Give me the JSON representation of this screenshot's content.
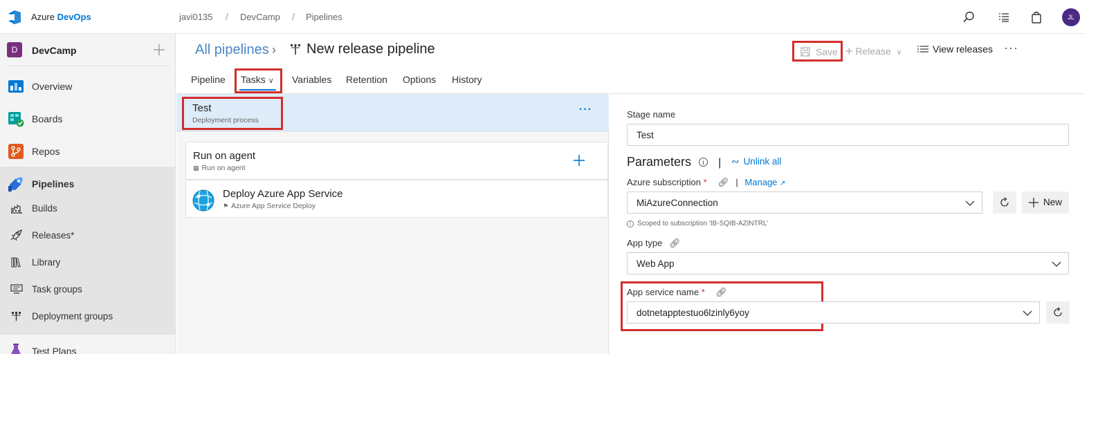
{
  "app": {
    "brand_prefix": "Azure ",
    "brand_suffix": "DevOps",
    "breadcrumb": [
      "javi0135",
      "DevCamp",
      "Pipelines"
    ],
    "avatar_initials": "JL"
  },
  "sidebar": {
    "project_initial": "D",
    "project_name": "DevCamp",
    "items": [
      {
        "label": "Overview",
        "icon": "overview-icon"
      },
      {
        "label": "Boards",
        "icon": "boards-icon"
      },
      {
        "label": "Repos",
        "icon": "repos-icon"
      },
      {
        "label": "Pipelines",
        "icon": "pipelines-icon"
      }
    ],
    "sub_items": [
      {
        "label": "Builds",
        "icon": "builds-icon"
      },
      {
        "label": "Releases*",
        "icon": "rocket-icon"
      },
      {
        "label": "Library",
        "icon": "library-icon"
      },
      {
        "label": "Task groups",
        "icon": "task-groups-icon"
      },
      {
        "label": "Deployment groups",
        "icon": "deployment-groups-icon"
      }
    ],
    "next_item": {
      "label": "Test Plans",
      "icon": "test-plans-icon"
    }
  },
  "header": {
    "all_pipelines": "All pipelines",
    "chevron": "›",
    "title": "New release pipeline",
    "save_label": "Save",
    "release_label": "Release",
    "view_releases_label": "View releases",
    "more": "···"
  },
  "tabs": [
    "Pipeline",
    "Tasks",
    "Variables",
    "Retention",
    "Options",
    "History"
  ],
  "stage": {
    "name": "Test",
    "subtitle": "Deployment process",
    "more": "···"
  },
  "agent_job": {
    "name": "Run on agent",
    "subtitle": "Run on agent",
    "add": "+"
  },
  "task": {
    "name": "Deploy Azure App Service",
    "subtitle": "Azure App Service Deploy"
  },
  "form": {
    "stage_name_label": "Stage name",
    "stage_name_value": "Test",
    "parameters_label": "Parameters",
    "unlink_all": "Unlink all",
    "azure_subscription_label": "Azure subscription",
    "manage_label": "Manage",
    "subscription_value": "MiAzureConnection",
    "new_label": "New",
    "scope_hint": "Scoped to subscription 'IB-SQIB-AZINTRL'",
    "app_type_label": "App type",
    "app_type_value": "Web App",
    "app_service_name_label": "App service name",
    "app_service_name_value": "dotnetapptestuo6lzinly6yoy",
    "required_marker": "*",
    "separator": "|"
  },
  "colors": {
    "accent": "#0078d4",
    "highlight_box": "#d32d2d",
    "selected_stage": "#deecf9",
    "project_badge": "#7b2f7d",
    "avatar": "#4b2a85"
  }
}
